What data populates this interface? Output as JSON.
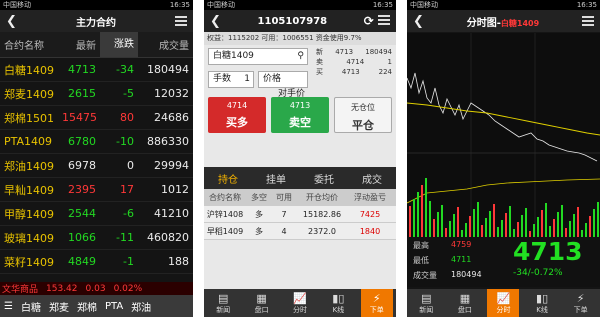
{
  "p1": {
    "status": "中国移动",
    "time": "16:35",
    "title": "主力合约",
    "headers": [
      "合约名称",
      "最新",
      "涨跌",
      "成交量"
    ],
    "rows": [
      {
        "name": "白糖1409",
        "last": "4713",
        "chg": "-34",
        "vol": "180494",
        "c": "dn"
      },
      {
        "name": "郑麦1409",
        "last": "2615",
        "chg": "-5",
        "vol": "12032",
        "c": "dn"
      },
      {
        "name": "郑棉1501",
        "last": "15475",
        "chg": "80",
        "vol": "24686",
        "c": "up"
      },
      {
        "name": "PTA1409",
        "last": "6780",
        "chg": "-10",
        "vol": "886330",
        "c": "dn"
      },
      {
        "name": "郑油1409",
        "last": "6978",
        "chg": "0",
        "vol": "29994",
        "c": "wh"
      },
      {
        "name": "早籼1409",
        "last": "2395",
        "chg": "17",
        "vol": "1012",
        "c": "up"
      },
      {
        "name": "甲醇1409",
        "last": "2544",
        "chg": "-6",
        "vol": "41210",
        "c": "dn"
      },
      {
        "name": "玻璃1409",
        "last": "1066",
        "chg": "-11",
        "vol": "460820",
        "c": "dn"
      },
      {
        "name": "菜籽1409",
        "last": "4849",
        "chg": "-1",
        "vol": "188",
        "c": "dn"
      }
    ],
    "ticker": {
      "name": "文华商品",
      "a": "153.42",
      "b": "0.03",
      "c": "0.02%"
    },
    "tabs": [
      "白糖",
      "郑麦",
      "郑棉",
      "PTA",
      "郑油"
    ]
  },
  "p2": {
    "status": "中国移动",
    "time": "16:35",
    "title": "1105107978",
    "acct": "权益：1115202  可用：1006551  资金使用9.7%",
    "contract": "白糖1409",
    "qty_label": "手数",
    "qty": "1",
    "price_label": "价格",
    "price_type": "对手价",
    "quote": [
      [
        "新",
        "4713",
        "180494"
      ],
      [
        "卖",
        "4714",
        "1"
      ],
      [
        "买",
        "4713",
        "224"
      ]
    ],
    "buy": {
      "price": "4714",
      "label": "买多"
    },
    "sell": {
      "price": "4713",
      "label": "卖空"
    },
    "close": {
      "price": "无仓位",
      "label": "平仓"
    },
    "tabs": [
      "持仓",
      "挂单",
      "委托",
      "成交"
    ],
    "pos_headers": [
      "合约名称",
      "多空",
      "可用",
      "开仓均价",
      "浮动盈亏"
    ],
    "positions": [
      [
        "沪锌1408",
        "多",
        "7",
        "15182.86",
        "7425"
      ],
      [
        "早稻1409",
        "多",
        "4",
        "2372.0",
        "1840"
      ]
    ],
    "bottom": [
      "新闻",
      "盘口",
      "分时",
      "K线",
      "下单"
    ]
  },
  "p3": {
    "status": "中国移动",
    "time": "16:35",
    "title": "分时图-",
    "title_sub": "白糖1409",
    "high_label": "最高",
    "high": "4759",
    "low_label": "最低",
    "low": "4711",
    "vol_label": "成交量",
    "vol": "180494",
    "price": "4713",
    "change": "-34/-0.72%",
    "bottom": [
      "新闻",
      "盘口",
      "分时",
      "K线",
      "下单"
    ]
  }
}
